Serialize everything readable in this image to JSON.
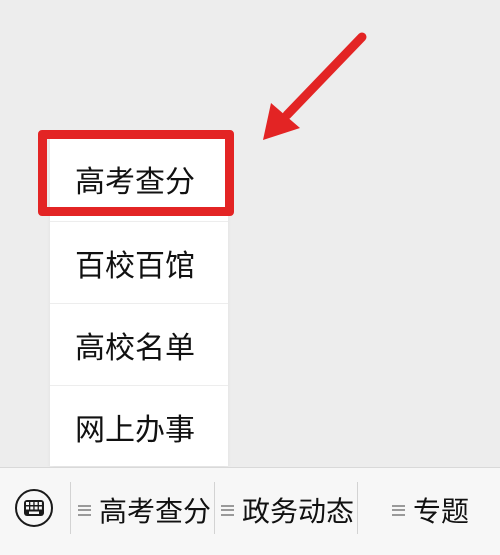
{
  "colors": {
    "background": "#ededed",
    "highlight": "#e32424",
    "menu_background": "#ffffff",
    "text": "#111111"
  },
  "popup_menu": {
    "items": [
      {
        "label": "高考查分"
      },
      {
        "label": "百校百馆"
      },
      {
        "label": "高校名单"
      },
      {
        "label": "网上办事"
      }
    ]
  },
  "bottom_bar": {
    "keyboard_icon": "keyboard-icon",
    "tabs": [
      {
        "label": "高考查分",
        "icon": "menu-lines-icon"
      },
      {
        "label": "政务动态",
        "icon": "menu-lines-icon"
      },
      {
        "label": "专题",
        "icon": "menu-lines-icon"
      }
    ]
  }
}
